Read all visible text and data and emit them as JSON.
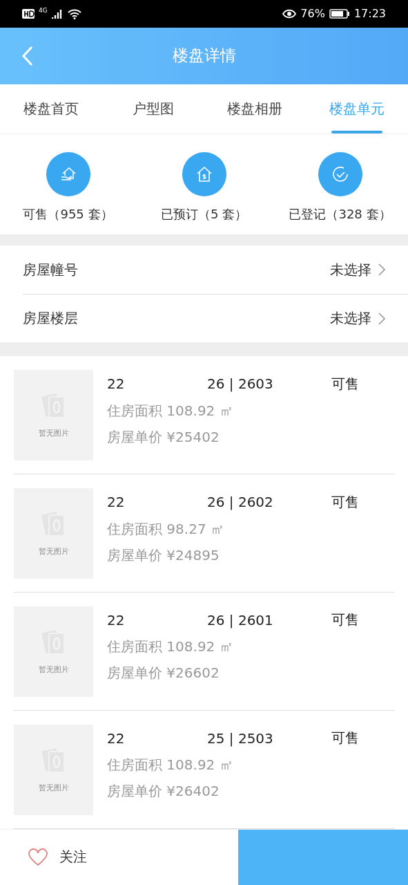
{
  "status_bar": {
    "network": "4G",
    "battery": "76%",
    "time": "17:23"
  },
  "header": {
    "title": "楼盘详情"
  },
  "tabs": [
    {
      "label": "楼盘首页",
      "selected": false
    },
    {
      "label": "户型图",
      "selected": false
    },
    {
      "label": "楼盘相册",
      "selected": false
    },
    {
      "label": "楼盘单元",
      "selected": true
    }
  ],
  "stats": [
    {
      "kind": "house",
      "label": "可售（955 套）"
    },
    {
      "kind": "price",
      "label": "已预订（5 套）"
    },
    {
      "kind": "check",
      "label": "已登记（328 套）"
    }
  ],
  "filters": [
    {
      "label": "房屋幢号",
      "value": "未选择"
    },
    {
      "label": "房屋楼层",
      "value": "未选择"
    }
  ],
  "units": [
    {
      "placeholder_text": "暂无图片",
      "building": "22",
      "unit": "26 | 2603",
      "status": "可售",
      "area": "住房面积 108.92 ㎡",
      "price": "房屋单价 ¥25402"
    },
    {
      "placeholder_text": "暂无图片",
      "building": "22",
      "unit": "26 | 2602",
      "status": "可售",
      "area": "住房面积 98.27 ㎡",
      "price": "房屋单价 ¥24895"
    },
    {
      "placeholder_text": "暂无图片",
      "building": "22",
      "unit": "26 | 2601",
      "status": "可售",
      "area": "住房面积 108.92 ㎡",
      "price": "房屋单价 ¥26602"
    },
    {
      "placeholder_text": "暂无图片",
      "building": "22",
      "unit": "25 | 2503",
      "status": "可售",
      "area": "住房面积 108.92 ㎡",
      "price": "房屋单价 ¥26402"
    }
  ],
  "bottom_bar": {
    "follow": "关注"
  }
}
